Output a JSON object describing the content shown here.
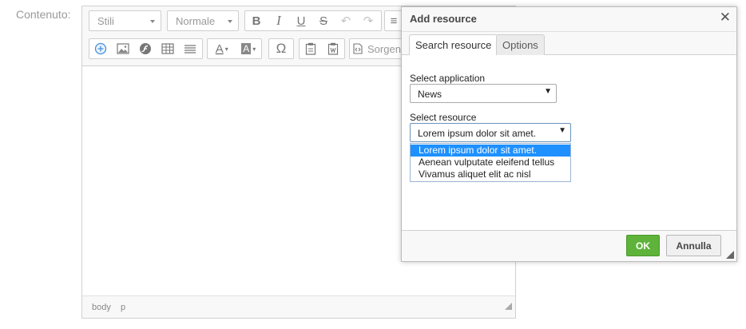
{
  "form": {
    "field_label": "Contenuto:"
  },
  "editor": {
    "styles_combo": "Stili",
    "format_combo": "Normale",
    "source_label": "Sorgen",
    "icons": {
      "bold": "B",
      "italic": "I",
      "underline": "U",
      "strike": "S",
      "undo": "↶",
      "redo": "↷",
      "list": "≡",
      "special_char": "Ω",
      "text_color": "A",
      "bg_color": "A"
    },
    "statusbar": {
      "path": [
        "body",
        "p"
      ]
    }
  },
  "dialog": {
    "title": "Add resource",
    "close_glyph": "✕",
    "tabs": [
      {
        "label": "Search resource",
        "active": true
      },
      {
        "label": "Options",
        "active": false
      }
    ],
    "application": {
      "label": "Select application",
      "value": "News"
    },
    "resource": {
      "label": "Select resource",
      "value": "Lorem ipsum dolor sit amet.",
      "options": [
        "Lorem ipsum dolor sit amet.",
        "Aenean vulputate eleifend tellus",
        "Vivamus aliquet elit ac nisl"
      ]
    },
    "buttons": {
      "ok": "OK",
      "cancel": "Annulla"
    },
    "dropdown_caret": "▼"
  },
  "colors": {
    "ok_green": "#5fb33b",
    "selection_blue": "#1e90ff",
    "accent_blue": "#4a90d9"
  }
}
